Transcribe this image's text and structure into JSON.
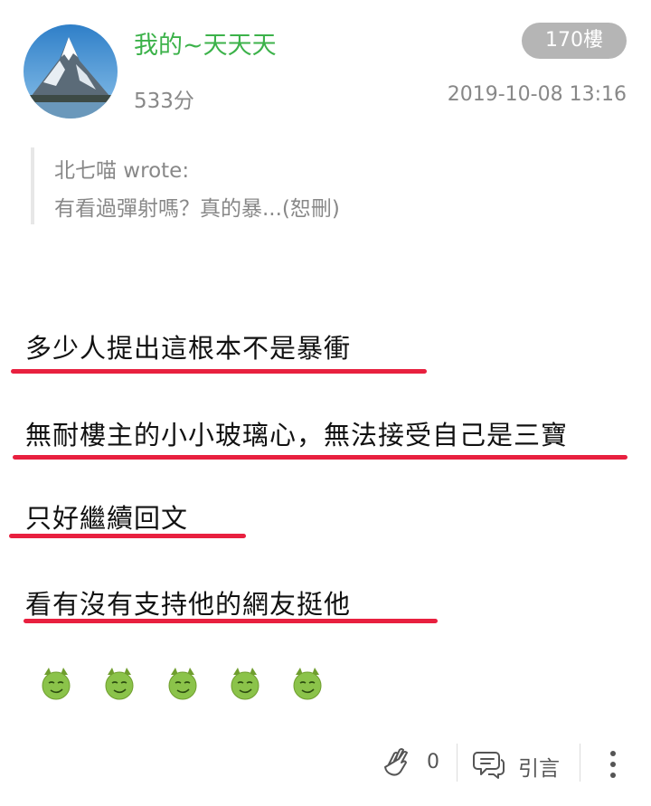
{
  "post": {
    "username": "我的~天天天",
    "points": "533分",
    "floor": "170樓",
    "timestamp": "2019-10-08 13:16"
  },
  "quote": {
    "author": "北七喵 wrote:",
    "text": "有看過彈射嗎？真的暴...(恕刪)"
  },
  "content": {
    "lines": [
      "多少人提出這根本不是暴衝",
      "無耐樓主的小小玻璃心，無法接受自己是三寶",
      "只好繼續回文",
      "看有沒有支持他的網友挺他"
    ],
    "underline_color": "#e8203f"
  },
  "emojis": [
    "smirk-emoji",
    "smirk-emoji",
    "smirk-emoji",
    "smirk-emoji",
    "smirk-emoji"
  ],
  "footer": {
    "like_count": "0",
    "quote_label": "引言",
    "icons": [
      "clap-icon",
      "quote-bubble-icon",
      "more-vertical-icon"
    ]
  },
  "colors": {
    "username": "#3cb24a",
    "badge_bg": "#b5b5b5",
    "meta_text": "#888888",
    "emoji_green": "#8bc34a"
  }
}
